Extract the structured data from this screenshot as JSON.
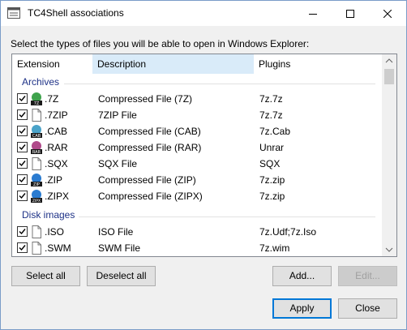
{
  "window": {
    "title": "TC4Shell associations"
  },
  "prompt": "Select the types of files you will be able to open in Windows Explorer:",
  "list": {
    "columns": [
      "Extension",
      "Description",
      "Plugins"
    ],
    "groups": [
      {
        "label": "Archives",
        "rows": [
          {
            "ext": ".7Z",
            "desc": "Compressed File (7Z)",
            "plugin": "7z.7z",
            "checked": true,
            "icon": "7z-archive-icon"
          },
          {
            "ext": ".7ZIP",
            "desc": "7ZIP File",
            "plugin": "7z.7z",
            "checked": true,
            "icon": "blank-file-icon"
          },
          {
            "ext": ".CAB",
            "desc": "Compressed File (CAB)",
            "plugin": "7z.Cab",
            "checked": true,
            "icon": "cab-archive-icon"
          },
          {
            "ext": ".RAR",
            "desc": "Compressed File (RAR)",
            "plugin": "Unrar",
            "checked": true,
            "icon": "rar-archive-icon"
          },
          {
            "ext": ".SQX",
            "desc": "SQX File",
            "plugin": "SQX",
            "checked": true,
            "icon": "blank-file-icon"
          },
          {
            "ext": ".ZIP",
            "desc": "Compressed File (ZIP)",
            "plugin": "7z.zip",
            "checked": true,
            "icon": "zip-archive-icon"
          },
          {
            "ext": ".ZIPX",
            "desc": "Compressed File (ZIPX)",
            "plugin": "7z.zip",
            "checked": true,
            "icon": "zipx-archive-icon"
          }
        ]
      },
      {
        "label": "Disk images",
        "rows": [
          {
            "ext": ".ISO",
            "desc": "ISO File",
            "plugin": "7z.Udf;7z.Iso",
            "checked": true,
            "icon": "blank-file-icon"
          },
          {
            "ext": ".SWM",
            "desc": "SWM File",
            "plugin": "7z.wim",
            "checked": true,
            "icon": "blank-file-icon"
          }
        ]
      }
    ]
  },
  "buttons": {
    "select_all": "Select all",
    "deselect_all": "Deselect all",
    "add": "Add...",
    "edit": "Edit...",
    "apply": "Apply",
    "close": "Close"
  },
  "colors": {
    "group_label": "#1e3287",
    "selected_column": "#d9ebf9",
    "default_button_border": "#0078d7"
  }
}
